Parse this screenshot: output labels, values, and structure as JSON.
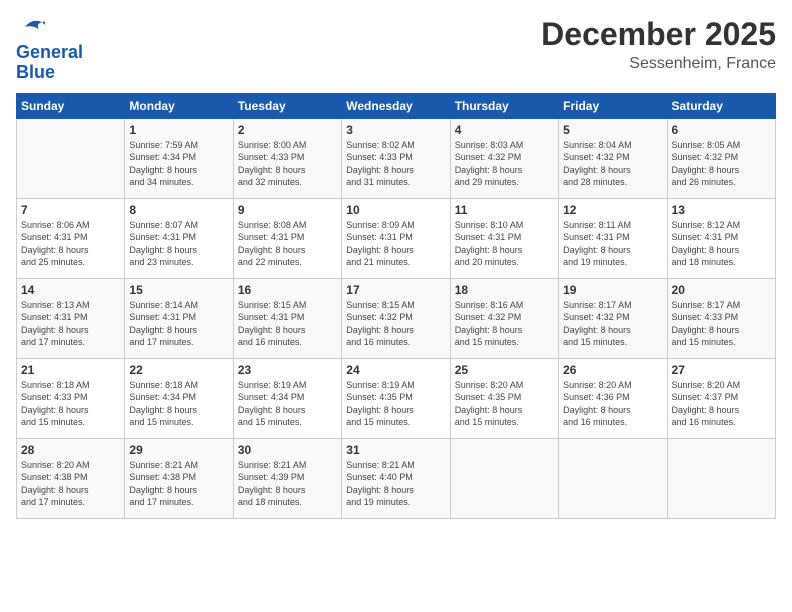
{
  "header": {
    "logo_line1": "General",
    "logo_line2": "Blue",
    "month": "December 2025",
    "location": "Sessenheim, France"
  },
  "days_of_week": [
    "Sunday",
    "Monday",
    "Tuesday",
    "Wednesday",
    "Thursday",
    "Friday",
    "Saturday"
  ],
  "weeks": [
    [
      {
        "day": "",
        "info": ""
      },
      {
        "day": "1",
        "info": "Sunrise: 7:59 AM\nSunset: 4:34 PM\nDaylight: 8 hours\nand 34 minutes."
      },
      {
        "day": "2",
        "info": "Sunrise: 8:00 AM\nSunset: 4:33 PM\nDaylight: 8 hours\nand 32 minutes."
      },
      {
        "day": "3",
        "info": "Sunrise: 8:02 AM\nSunset: 4:33 PM\nDaylight: 8 hours\nand 31 minutes."
      },
      {
        "day": "4",
        "info": "Sunrise: 8:03 AM\nSunset: 4:32 PM\nDaylight: 8 hours\nand 29 minutes."
      },
      {
        "day": "5",
        "info": "Sunrise: 8:04 AM\nSunset: 4:32 PM\nDaylight: 8 hours\nand 28 minutes."
      },
      {
        "day": "6",
        "info": "Sunrise: 8:05 AM\nSunset: 4:32 PM\nDaylight: 8 hours\nand 26 minutes."
      }
    ],
    [
      {
        "day": "7",
        "info": "Sunrise: 8:06 AM\nSunset: 4:31 PM\nDaylight: 8 hours\nand 25 minutes."
      },
      {
        "day": "8",
        "info": "Sunrise: 8:07 AM\nSunset: 4:31 PM\nDaylight: 8 hours\nand 23 minutes."
      },
      {
        "day": "9",
        "info": "Sunrise: 8:08 AM\nSunset: 4:31 PM\nDaylight: 8 hours\nand 22 minutes."
      },
      {
        "day": "10",
        "info": "Sunrise: 8:09 AM\nSunset: 4:31 PM\nDaylight: 8 hours\nand 21 minutes."
      },
      {
        "day": "11",
        "info": "Sunrise: 8:10 AM\nSunset: 4:31 PM\nDaylight: 8 hours\nand 20 minutes."
      },
      {
        "day": "12",
        "info": "Sunrise: 8:11 AM\nSunset: 4:31 PM\nDaylight: 8 hours\nand 19 minutes."
      },
      {
        "day": "13",
        "info": "Sunrise: 8:12 AM\nSunset: 4:31 PM\nDaylight: 8 hours\nand 18 minutes."
      }
    ],
    [
      {
        "day": "14",
        "info": "Sunrise: 8:13 AM\nSunset: 4:31 PM\nDaylight: 8 hours\nand 17 minutes."
      },
      {
        "day": "15",
        "info": "Sunrise: 8:14 AM\nSunset: 4:31 PM\nDaylight: 8 hours\nand 17 minutes."
      },
      {
        "day": "16",
        "info": "Sunrise: 8:15 AM\nSunset: 4:31 PM\nDaylight: 8 hours\nand 16 minutes."
      },
      {
        "day": "17",
        "info": "Sunrise: 8:15 AM\nSunset: 4:32 PM\nDaylight: 8 hours\nand 16 minutes."
      },
      {
        "day": "18",
        "info": "Sunrise: 8:16 AM\nSunset: 4:32 PM\nDaylight: 8 hours\nand 15 minutes."
      },
      {
        "day": "19",
        "info": "Sunrise: 8:17 AM\nSunset: 4:32 PM\nDaylight: 8 hours\nand 15 minutes."
      },
      {
        "day": "20",
        "info": "Sunrise: 8:17 AM\nSunset: 4:33 PM\nDaylight: 8 hours\nand 15 minutes."
      }
    ],
    [
      {
        "day": "21",
        "info": "Sunrise: 8:18 AM\nSunset: 4:33 PM\nDaylight: 8 hours\nand 15 minutes."
      },
      {
        "day": "22",
        "info": "Sunrise: 8:18 AM\nSunset: 4:34 PM\nDaylight: 8 hours\nand 15 minutes."
      },
      {
        "day": "23",
        "info": "Sunrise: 8:19 AM\nSunset: 4:34 PM\nDaylight: 8 hours\nand 15 minutes."
      },
      {
        "day": "24",
        "info": "Sunrise: 8:19 AM\nSunset: 4:35 PM\nDaylight: 8 hours\nand 15 minutes."
      },
      {
        "day": "25",
        "info": "Sunrise: 8:20 AM\nSunset: 4:35 PM\nDaylight: 8 hours\nand 15 minutes."
      },
      {
        "day": "26",
        "info": "Sunrise: 8:20 AM\nSunset: 4:36 PM\nDaylight: 8 hours\nand 16 minutes."
      },
      {
        "day": "27",
        "info": "Sunrise: 8:20 AM\nSunset: 4:37 PM\nDaylight: 8 hours\nand 16 minutes."
      }
    ],
    [
      {
        "day": "28",
        "info": "Sunrise: 8:20 AM\nSunset: 4:38 PM\nDaylight: 8 hours\nand 17 minutes."
      },
      {
        "day": "29",
        "info": "Sunrise: 8:21 AM\nSunset: 4:38 PM\nDaylight: 8 hours\nand 17 minutes."
      },
      {
        "day": "30",
        "info": "Sunrise: 8:21 AM\nSunset: 4:39 PM\nDaylight: 8 hours\nand 18 minutes."
      },
      {
        "day": "31",
        "info": "Sunrise: 8:21 AM\nSunset: 4:40 PM\nDaylight: 8 hours\nand 19 minutes."
      },
      {
        "day": "",
        "info": ""
      },
      {
        "day": "",
        "info": ""
      },
      {
        "day": "",
        "info": ""
      }
    ]
  ]
}
